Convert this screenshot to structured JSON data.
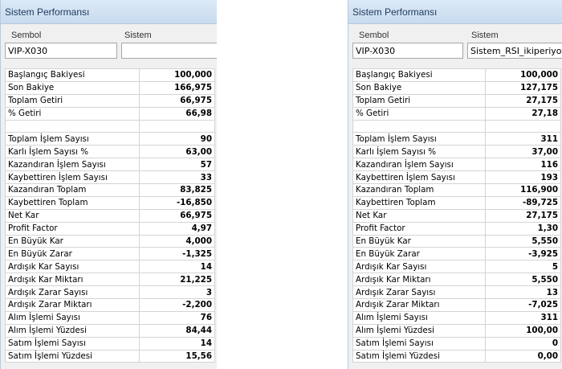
{
  "left": {
    "title": "Sistem Performansı",
    "sembol_label": "Sembol",
    "sistem_label": "Sistem",
    "sembol_value": "VIP-X030",
    "sistem_value": "",
    "rows": [
      {
        "label": "Başlangıç Bakiyesi",
        "value": "100,000"
      },
      {
        "label": "Son Bakiye",
        "value": "166,975"
      },
      {
        "label": "Toplam Getiri",
        "value": "66,975"
      },
      {
        "label": "% Getiri",
        "value": "66,98"
      },
      {
        "label": "",
        "value": ""
      },
      {
        "label": "Toplam İşlem Sayısı",
        "value": "90"
      },
      {
        "label": "Karlı İşlem Sayısı %",
        "value": "63,00"
      },
      {
        "label": "Kazandıran İşlem Sayısı",
        "value": "57"
      },
      {
        "label": "Kaybettiren İşlem Sayısı",
        "value": "33"
      },
      {
        "label": "Kazandıran Toplam",
        "value": "83,825"
      },
      {
        "label": "Kaybettiren Toplam",
        "value": "-16,850"
      },
      {
        "label": "Net Kar",
        "value": "66,975"
      },
      {
        "label": "Profit Factor",
        "value": "4,97"
      },
      {
        "label": "En Büyük Kar",
        "value": "4,000"
      },
      {
        "label": "En Büyük Zarar",
        "value": "-1,325"
      },
      {
        "label": "Ardışık Kar Sayısı",
        "value": "14"
      },
      {
        "label": "Ardışık Kar Miktarı",
        "value": "21,225"
      },
      {
        "label": "Ardışık Zarar Sayısı",
        "value": "3"
      },
      {
        "label": "Ardışık Zarar Miktarı",
        "value": "-2,200"
      },
      {
        "label": "Alım İşlemi Sayısı",
        "value": "76"
      },
      {
        "label": "Alım İşlemi Yüzdesi",
        "value": "84,44"
      },
      {
        "label": "Satım İşlemi Sayısı",
        "value": "14"
      },
      {
        "label": "Satım İşlemi Yüzdesi",
        "value": "15,56"
      }
    ]
  },
  "right": {
    "title": "Sistem Performansı",
    "sembol_label": "Sembol",
    "sistem_label": "Sistem",
    "sembol_value": "VIP-X030",
    "sistem_value": "Sistem_RSI_ikiperiyot",
    "rows": [
      {
        "label": "Başlangıç Bakiyesi",
        "value": "100,000"
      },
      {
        "label": "Son Bakiye",
        "value": "127,175"
      },
      {
        "label": "Toplam Getiri",
        "value": "27,175"
      },
      {
        "label": "% Getiri",
        "value": "27,18"
      },
      {
        "label": "",
        "value": ""
      },
      {
        "label": "Toplam İşlem Sayısı",
        "value": "311"
      },
      {
        "label": "Karlı İşlem Sayısı %",
        "value": "37,00"
      },
      {
        "label": "Kazandıran İşlem Sayısı",
        "value": "116"
      },
      {
        "label": "Kaybettiren İşlem Sayısı",
        "value": "193"
      },
      {
        "label": "Kazandıran Toplam",
        "value": "116,900"
      },
      {
        "label": "Kaybettiren Toplam",
        "value": "-89,725"
      },
      {
        "label": "Net Kar",
        "value": "27,175"
      },
      {
        "label": "Profit Factor",
        "value": "1,30"
      },
      {
        "label": "En Büyük Kar",
        "value": "5,550"
      },
      {
        "label": "En Büyük Zarar",
        "value": "-3,925"
      },
      {
        "label": "Ardışık Kar Sayısı",
        "value": "5"
      },
      {
        "label": "Ardışık Kar Miktarı",
        "value": "5,550"
      },
      {
        "label": "Ardışık Zarar Sayısı",
        "value": "13"
      },
      {
        "label": "Ardışık Zarar Miktarı",
        "value": "-7,025"
      },
      {
        "label": "Alım İşlemi Sayısı",
        "value": "311"
      },
      {
        "label": "Alım İşlemi Yüzdesi",
        "value": "100,00"
      },
      {
        "label": "Satım İşlemi Sayısı",
        "value": "0"
      },
      {
        "label": "Satım İşlemi Yüzdesi",
        "value": "0,00"
      }
    ]
  }
}
